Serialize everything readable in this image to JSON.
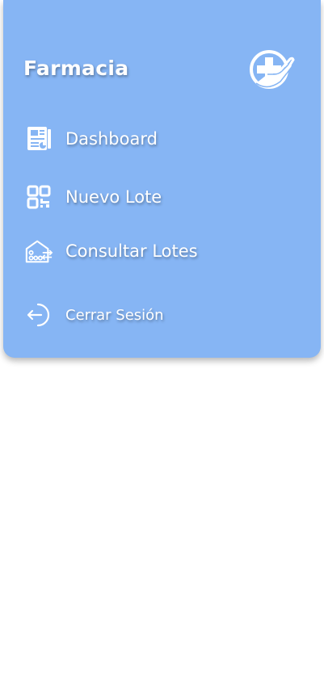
{
  "sidebar": {
    "brand": "Farmacia",
    "logo_icon": "pharmacy-cross-hand-icon",
    "items": [
      {
        "label": "Dashboard",
        "icon": "dashboard-document-icon"
      },
      {
        "label": "Nuevo Lote",
        "icon": "qr-code-icon"
      },
      {
        "label": "Consultar Lotes",
        "icon": "warehouse-transfer-icon"
      }
    ],
    "logout": {
      "label": "Cerrar Sesión",
      "icon": "logout-arrow-icon"
    }
  },
  "colors": {
    "panel": "#86b5f4",
    "text": "#ffffff",
    "page_background": "#ffffff"
  }
}
